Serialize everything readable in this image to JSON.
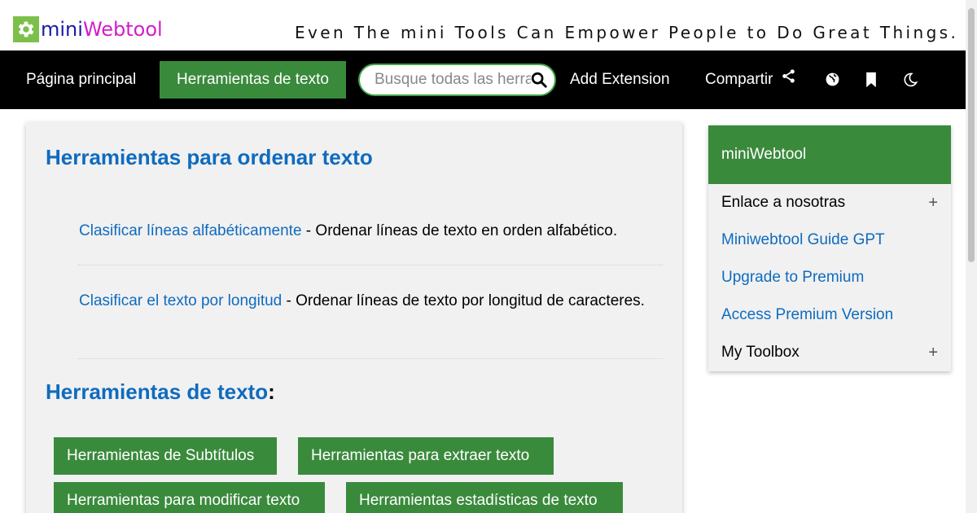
{
  "header": {
    "logo_mini": "mini",
    "logo_webtool": "Webtool",
    "slogan": "Even The mini Tools Can Empower People to Do Great Things."
  },
  "nav": {
    "home": "Página principal",
    "text_tools": "Herramientas de texto",
    "search_placeholder": "Busque todas las herramientas",
    "add_extension": "Add Extension",
    "share": "Compartir",
    "icons": [
      "share-icon",
      "globe-icon",
      "bookmark-icon",
      "moon-icon",
      "search-icon"
    ]
  },
  "main": {
    "title": "Herramientas para ordenar texto",
    "tools": [
      {
        "link": "Clasificar líneas alfabéticamente",
        "desc": " - Ordenar líneas de texto en orden alfabético."
      },
      {
        "link": "Clasificar el texto por longitud",
        "desc": " - Ordenar líneas de texto por longitud de caracteres."
      }
    ],
    "section_title": "Herramientas de texto",
    "section_colon": ":",
    "categories": [
      "Herramientas de Subtítulos",
      "Herramientas para extraer texto",
      "Herramientas para modificar texto",
      "Herramientas estadísticas de texto"
    ]
  },
  "sidebar": {
    "title": "miniWebtool",
    "items": [
      {
        "label": "Enlace a nosotras",
        "expand": "+"
      },
      {
        "label": "Miniwebtool Guide GPT"
      },
      {
        "label": "Upgrade to Premium"
      },
      {
        "label": "Access Premium Version"
      },
      {
        "label": "My Toolbox",
        "expand": "+"
      }
    ]
  },
  "colors": {
    "brand_green": "#3a8a3c",
    "link_blue": "#0f6bbf",
    "nav_bg": "#000000"
  }
}
